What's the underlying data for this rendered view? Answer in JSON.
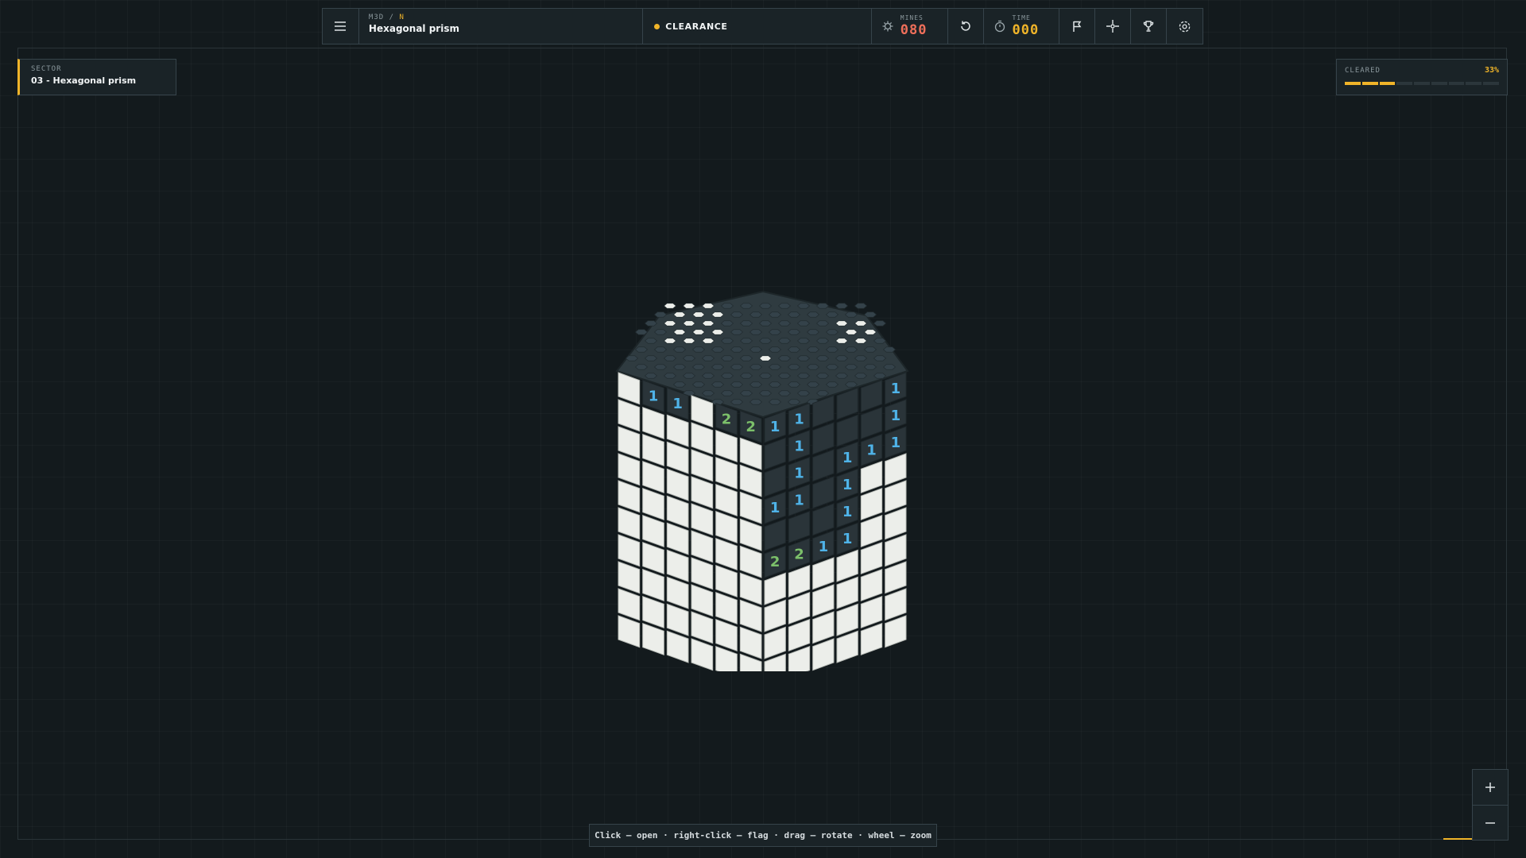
{
  "topbar": {
    "breadcrumb_prefix": "M3D /",
    "breadcrumb_mode": "N",
    "title": "Hexagonal prism",
    "status": "CLEARANCE",
    "mines_label": "MINES",
    "mines_value": "080",
    "time_label": "TIME",
    "time_value": "000"
  },
  "sector": {
    "label": "SECTOR",
    "name": "03 - Hexagonal prism"
  },
  "cleared": {
    "label": "CLEARED",
    "percent": "33%",
    "fraction": 0.33
  },
  "hint": "Click — open · right-click — flag · drag — rotate · wheel — zoom",
  "icons": [
    "menu-icon",
    "mine-icon",
    "restart-icon",
    "timer-icon",
    "flag-icon",
    "crosshair-icon",
    "trophy-icon",
    "settings-icon",
    "zoom-in-icon",
    "zoom-out-icon"
  ],
  "colors": {
    "accent": "#f0b429",
    "mines": "#ef6f5a",
    "number_1": "#4fb3e8",
    "number_2": "#7cc06a",
    "hidden_cell": "#eceeea",
    "revealed_cell": "#2a3439"
  },
  "board": {
    "left_face": [
      [
        "H",
        "1",
        "1",
        "H",
        "2",
        "2"
      ],
      [
        "H",
        "H",
        "H",
        "H",
        "H",
        "H"
      ],
      [
        "H",
        "H",
        "H",
        "H",
        "H",
        "H"
      ],
      [
        "H",
        "H",
        "H",
        "H",
        "H",
        "H"
      ],
      [
        "H",
        "H",
        "H",
        "H",
        "H",
        "H"
      ],
      [
        "H",
        "H",
        "H",
        "H",
        "H",
        "H"
      ],
      [
        "H",
        "H",
        "H",
        "H",
        "H",
        "H"
      ],
      [
        "H",
        "H",
        "H",
        "H",
        "H",
        "H"
      ],
      [
        "H",
        "H",
        "H",
        "H",
        "H",
        "H"
      ],
      [
        "H",
        "H",
        "H",
        "H",
        "H",
        "H"
      ]
    ],
    "right_face": [
      [
        "1",
        "1",
        "E",
        "E",
        "E",
        "1"
      ],
      [
        "E",
        "1",
        "E",
        "E",
        "E",
        "1"
      ],
      [
        "E",
        "1",
        "E",
        "1",
        "1",
        "1"
      ],
      [
        "1",
        "1",
        "E",
        "1",
        "H",
        "H"
      ],
      [
        "E",
        "E",
        "E",
        "1",
        "H",
        "H"
      ],
      [
        "2",
        "2",
        "1",
        "1",
        "H",
        "H"
      ],
      [
        "H",
        "H",
        "H",
        "H",
        "H",
        "H"
      ],
      [
        "H",
        "H",
        "H",
        "H",
        "H",
        "H"
      ],
      [
        "H",
        "H",
        "H",
        "H",
        "H",
        "H"
      ],
      [
        "H",
        "H",
        "H",
        "H",
        "H",
        "H"
      ]
    ]
  }
}
